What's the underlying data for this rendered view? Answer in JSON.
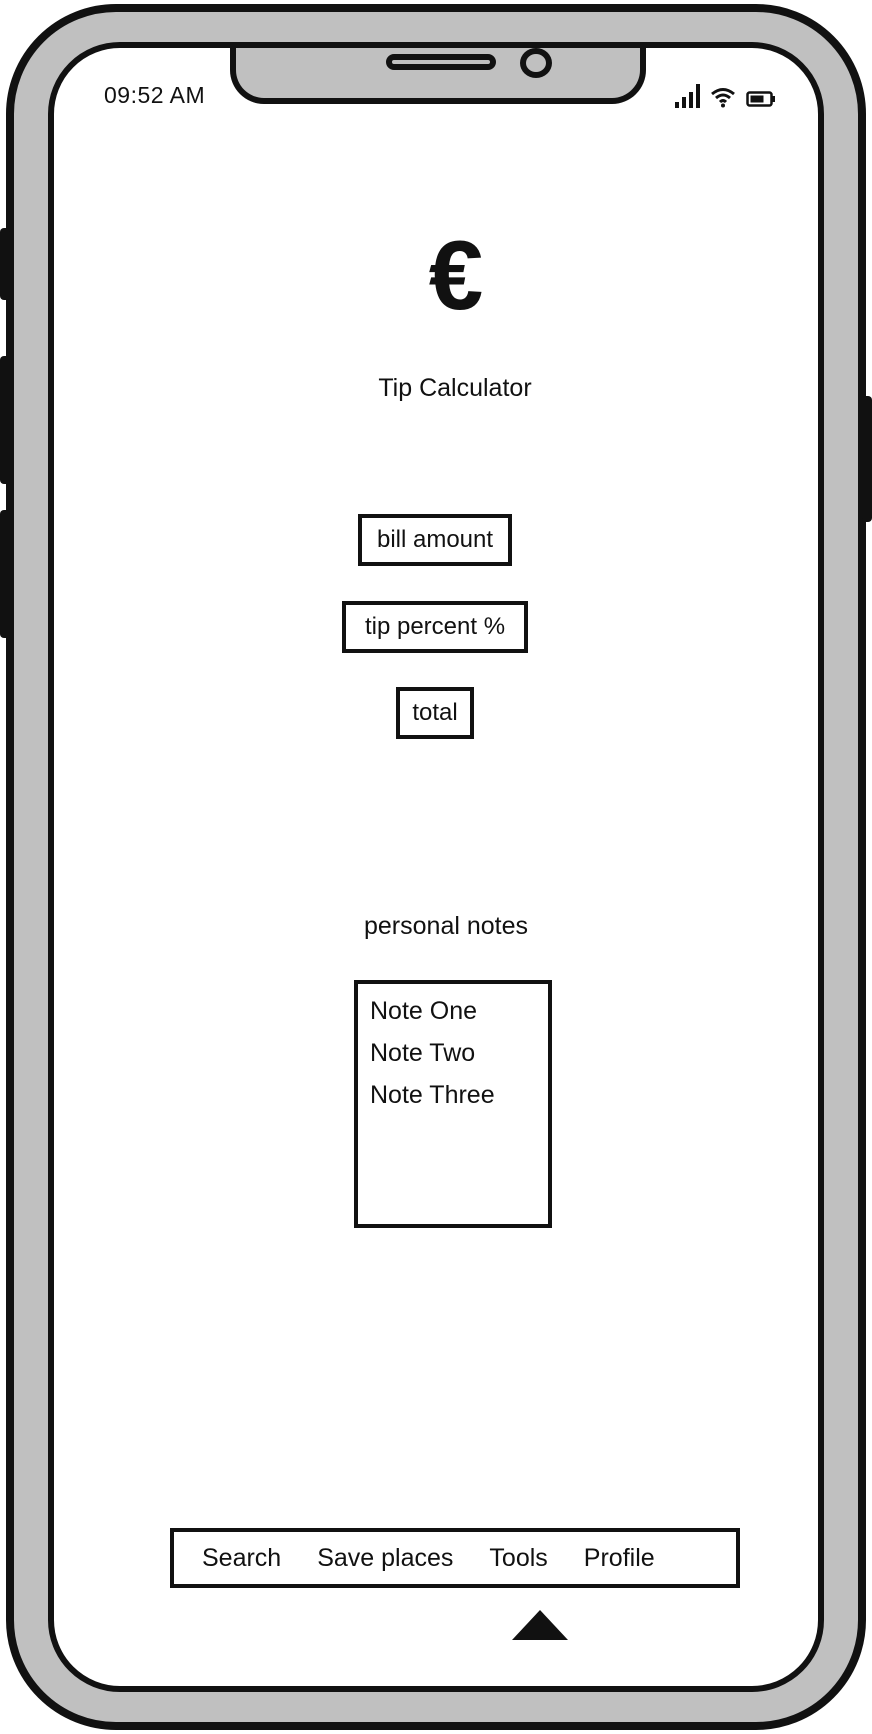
{
  "status_bar": {
    "time": "09:52 AM",
    "icons": [
      "signal-icon",
      "wifi-icon",
      "battery-icon"
    ]
  },
  "header": {
    "icon": "euro-icon",
    "icon_glyph": "€",
    "title": "Tip Calculator"
  },
  "form": {
    "bill_amount": "bill amount",
    "tip_percent": "tip percent %",
    "total": "total"
  },
  "notes": {
    "label": "personal notes",
    "items": [
      "Note One",
      "Note Two",
      "Note Three"
    ]
  },
  "bottom_nav": {
    "items": [
      "Search",
      "Save places",
      "Tools",
      "Profile"
    ]
  },
  "colors": {
    "frame": "#c0c0c0",
    "ink": "#111111",
    "screen": "#ffffff"
  }
}
